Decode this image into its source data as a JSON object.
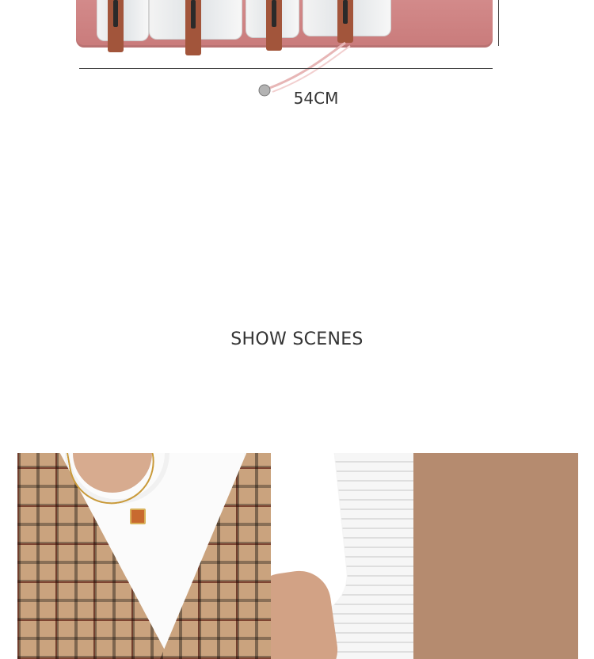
{
  "product_image": {
    "dimension_label": "54CM"
  },
  "section": {
    "title": "SHOW SCENES"
  },
  "scene_photo": {
    "description_elements": [
      "shirt",
      "plaid-vest",
      "necklace",
      "window-blinds",
      "wood-door"
    ]
  },
  "colors": {
    "pouch": "#c97b7b",
    "strap": "#a2553b",
    "text": "#333333"
  }
}
